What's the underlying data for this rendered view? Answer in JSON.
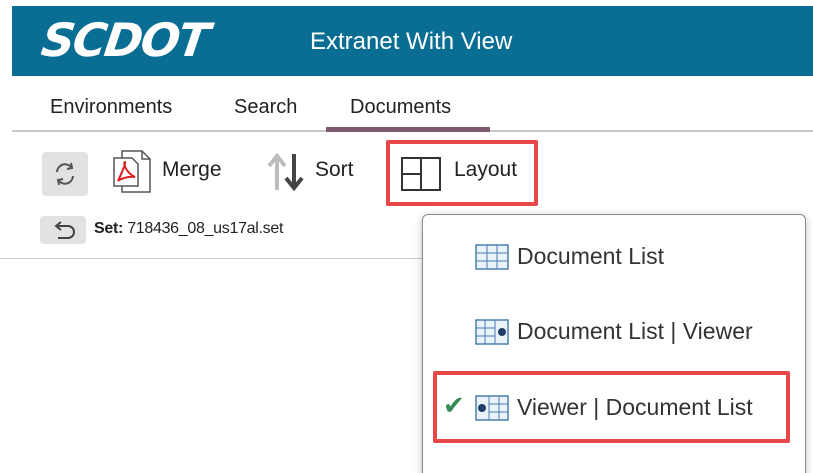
{
  "header": {
    "logo": "SCDOT",
    "app_title": "Extranet With View",
    "bg_color": "#0a6d93"
  },
  "nav": {
    "tabs": [
      {
        "label": "Environments"
      },
      {
        "label": "Search"
      },
      {
        "label": "Documents",
        "active": true
      }
    ]
  },
  "toolbar": {
    "refresh_icon": "refresh-icon",
    "merge_label": "Merge",
    "sort_label": "Sort",
    "layout_label": "Layout"
  },
  "set": {
    "key": "Set:",
    "value": "718436_08_us17al.set"
  },
  "layout_menu": {
    "items": [
      {
        "label": "Document List",
        "icon": "grid-icon",
        "checked": false
      },
      {
        "label": "Document List | Viewer",
        "icon": "grid-viewer-icon",
        "checked": false
      },
      {
        "label": "Viewer | Document List",
        "icon": "viewer-grid-icon",
        "checked": true
      }
    ],
    "check_glyph": "✔"
  },
  "colors": {
    "highlight": "#e8474a",
    "active_tab": "#7c5a6c",
    "check": "#3a8a55"
  }
}
